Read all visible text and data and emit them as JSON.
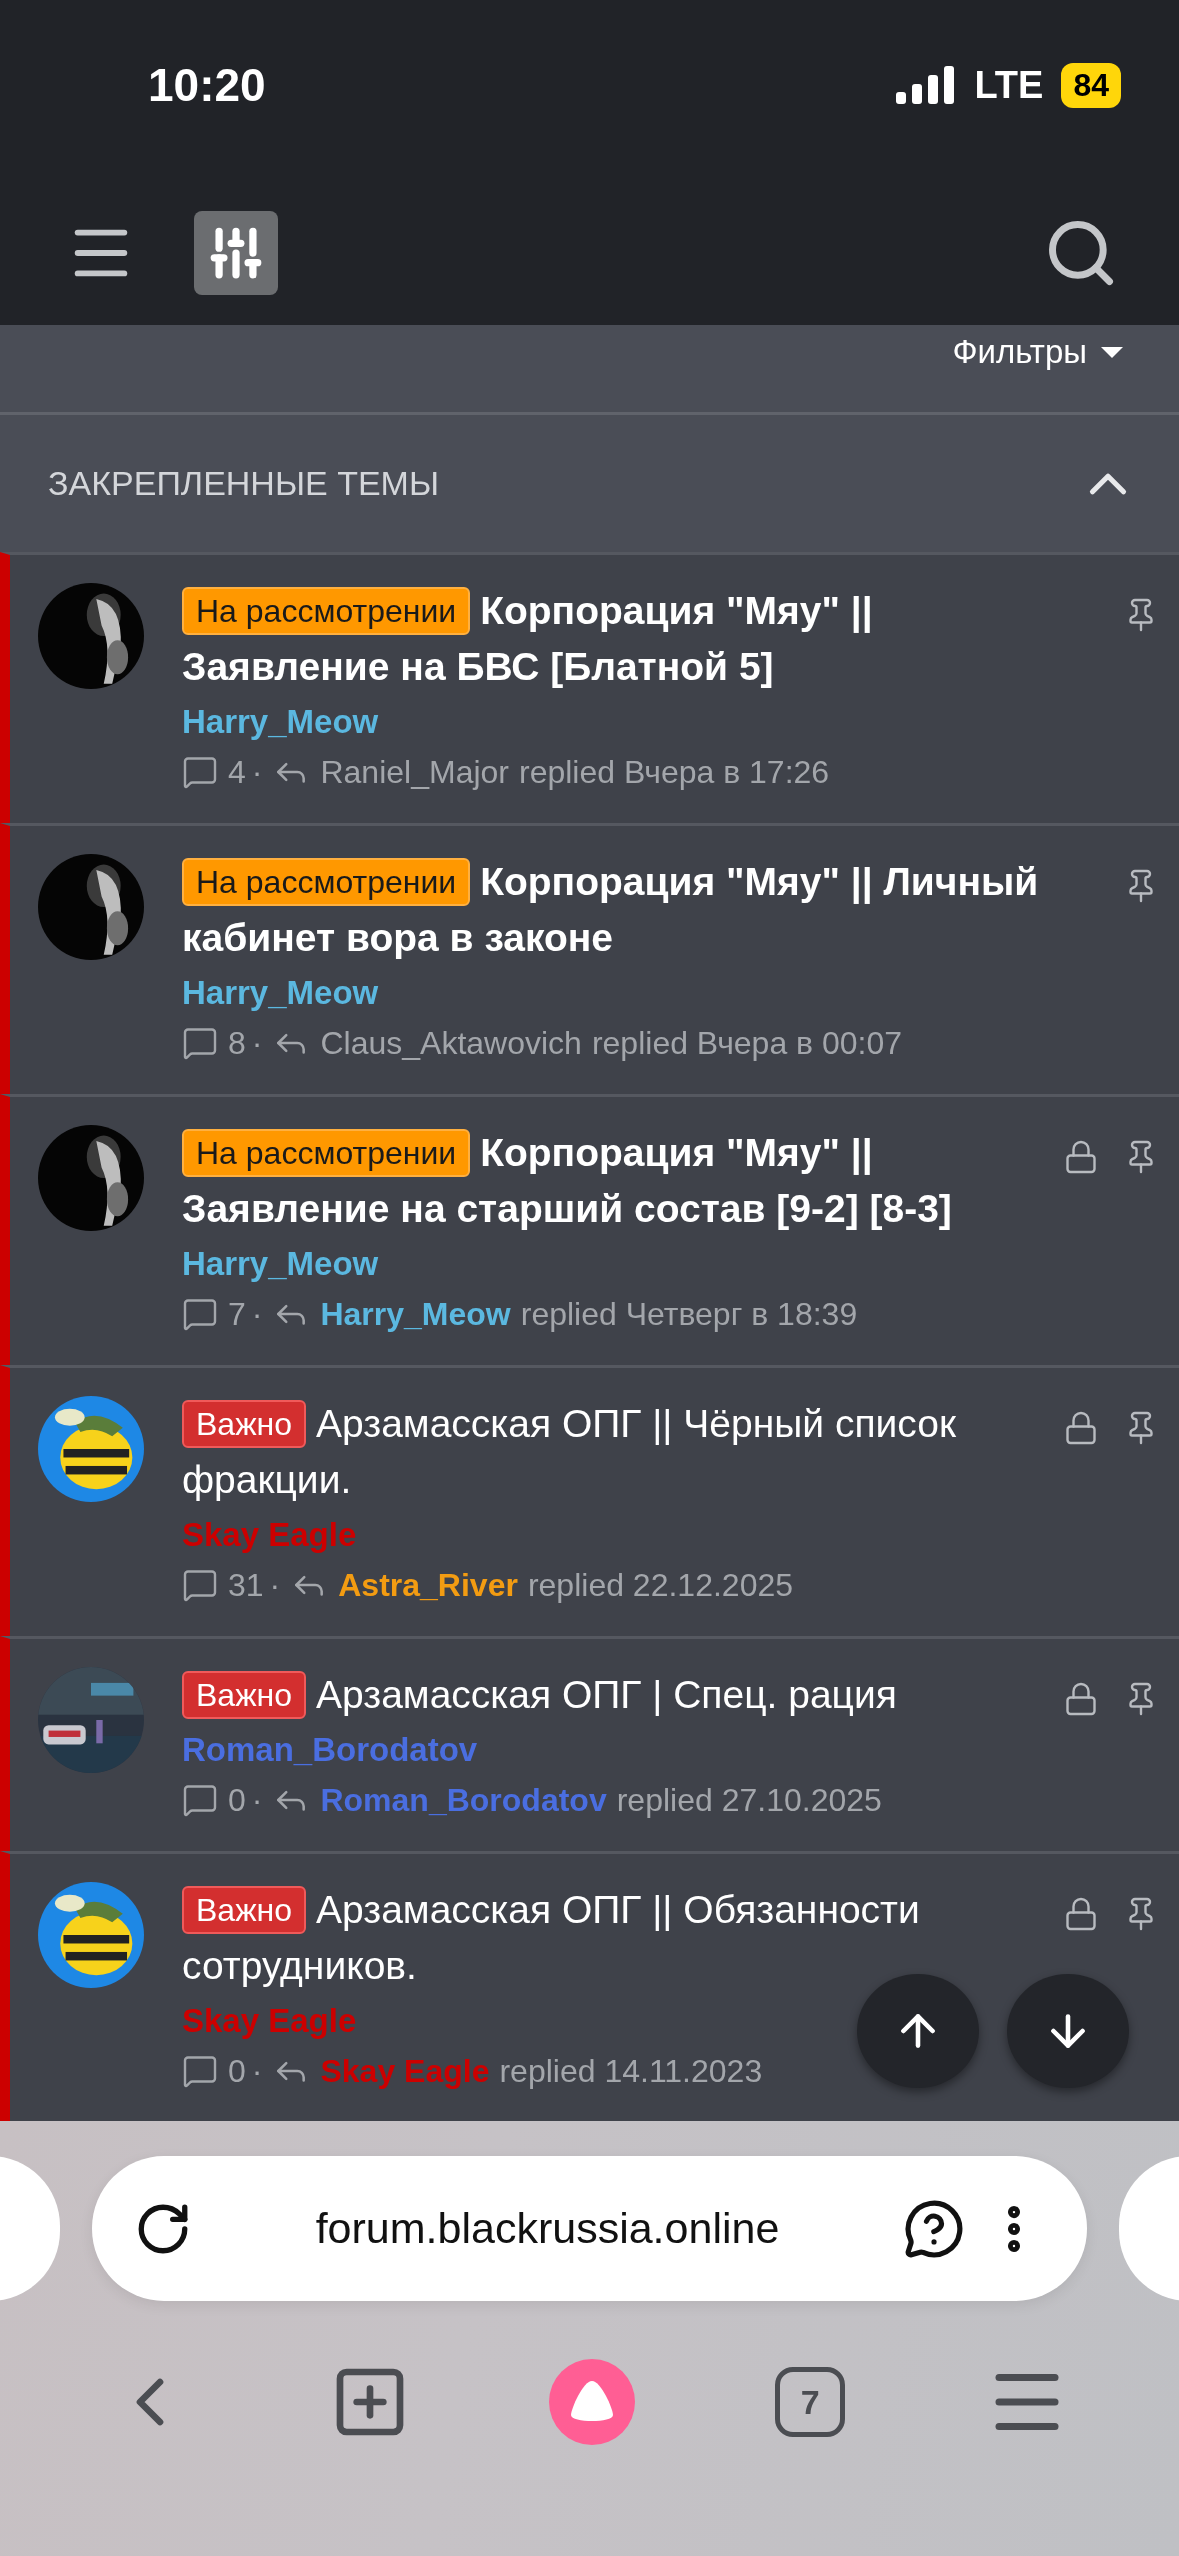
{
  "status_bar": {
    "time": "10:20",
    "network": "LTE",
    "battery": "84"
  },
  "filter_bar": {
    "label": "Фильтры"
  },
  "section": {
    "title": "ЗАКРЕПЛЕННЫЕ ТЕМЫ",
    "expanded": true
  },
  "threads": [
    {
      "prefix": {
        "label": "На рассмотрении",
        "kind": "review"
      },
      "title": "Корпорация \"Мяу\" || Заявление на БВС [Блатной 5]",
      "unread": true,
      "author": {
        "name": "Harry_Meow",
        "color": "#5bb8e0"
      },
      "replies": "4",
      "separator": "·",
      "last_poster": {
        "name": "Raniel_Major"
      },
      "reply_text": "replied Вчера в 17:26",
      "locked": false,
      "pinned": true
    },
    {
      "prefix": {
        "label": "На рассмотрении",
        "kind": "review"
      },
      "title": "Корпорация \"Мяу\" || Личный кабинет вора в законе",
      "unread": true,
      "author": {
        "name": "Harry_Meow",
        "color": "#5bb8e0"
      },
      "replies": "8",
      "separator": "·",
      "last_poster": {
        "name": "Claus_Aktawovich"
      },
      "reply_text": "replied Вчера в 00:07",
      "locked": false,
      "pinned": true
    },
    {
      "prefix": {
        "label": "На рассмотрении",
        "kind": "review"
      },
      "title": "Корпорация \"Мяу\" || Заявление на старший состав [9-2] [8-3]",
      "unread": true,
      "author": {
        "name": "Harry_Meow",
        "color": "#5bb8e0"
      },
      "replies": "7",
      "separator": "·",
      "last_poster": {
        "name": "Harry_Meow",
        "color": "#5bb8e0"
      },
      "reply_text": "replied Четверг в 18:39",
      "locked": true,
      "pinned": true
    },
    {
      "prefix": {
        "label": "Важно",
        "kind": "important"
      },
      "title": "Арзамасская ОПГ || Чёрный список фракции.",
      "unread": false,
      "author": {
        "name": "Skay Eagle",
        "color": "#cc0000"
      },
      "replies": "31",
      "separator": "·",
      "last_poster": {
        "name": "Astra_River",
        "color": "#f39c12"
      },
      "reply_text": "replied 22.12.2025",
      "locked": true,
      "pinned": true
    },
    {
      "prefix": {
        "label": "Важно",
        "kind": "important"
      },
      "title": "Арзамасская ОПГ | Спец. рация",
      "unread": false,
      "author": {
        "name": "Roman_Borodatov",
        "color": "#4a6ee0"
      },
      "replies": "0",
      "separator": "·",
      "last_poster": {
        "name": "Roman_Borodatov",
        "color": "#4a6ee0"
      },
      "reply_text": "replied 27.10.2025",
      "locked": true,
      "pinned": true
    },
    {
      "prefix": {
        "label": "Важно",
        "kind": "important"
      },
      "title": "Арзамасская ОПГ || Обязанности сотрудников.",
      "unread": false,
      "author": {
        "name": "Skay Eagle",
        "color": "#cc0000"
      },
      "replies": "0",
      "separator": "·",
      "last_poster": {
        "name": "Skay Eagle",
        "color": "#cc0000"
      },
      "reply_text": "replied 14.11.2023",
      "locked": true,
      "pinned": true
    }
  ],
  "browser": {
    "url": "forum.blackrussia.online",
    "tab_count": "7"
  }
}
